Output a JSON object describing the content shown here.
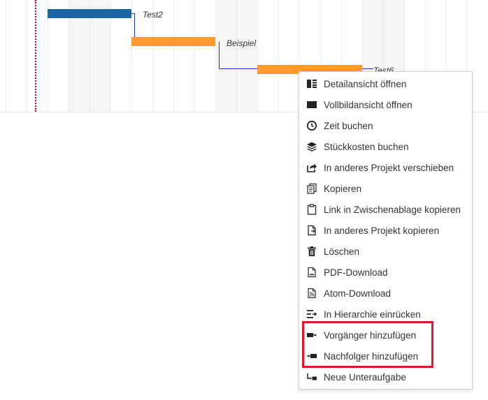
{
  "gantt": {
    "tasks": [
      {
        "label": "Test2",
        "color": "#1a67a3"
      },
      {
        "label": "Beispiel",
        "color": "#ff9a2e"
      },
      {
        "label": "Test6",
        "color": "#ff9a2e"
      }
    ],
    "today_line_color": "#d0021b"
  },
  "context_menu": {
    "items": [
      {
        "label": "Detailansicht öffnen",
        "icon": "detail-view-icon"
      },
      {
        "label": "Vollbildansicht öffnen",
        "icon": "fullscreen-icon"
      },
      {
        "label": "Zeit buchen",
        "icon": "clock-icon"
      },
      {
        "label": "Stückkosten buchen",
        "icon": "layers-icon"
      },
      {
        "label": "In anderes Projekt verschieben",
        "icon": "move-icon"
      },
      {
        "label": "Kopieren",
        "icon": "copy-icon"
      },
      {
        "label": "Link in Zwischenablage kopieren",
        "icon": "clipboard-icon"
      },
      {
        "label": "In anderes Projekt kopieren",
        "icon": "copy-to-project-icon"
      },
      {
        "label": "Löschen",
        "icon": "trash-icon"
      },
      {
        "label": "PDF-Download",
        "icon": "pdf-file-icon"
      },
      {
        "label": "Atom-Download",
        "icon": "atom-file-icon"
      },
      {
        "label": "In Hierarchie einrücken",
        "icon": "indent-icon"
      },
      {
        "label": "Vorgänger hinzufügen",
        "icon": "add-predecessor-icon"
      },
      {
        "label": "Nachfolger hinzufügen",
        "icon": "add-successor-icon"
      },
      {
        "label": "Neue Unteraufgabe",
        "icon": "subtask-icon"
      }
    ],
    "highlight_color": "#e0162b"
  }
}
